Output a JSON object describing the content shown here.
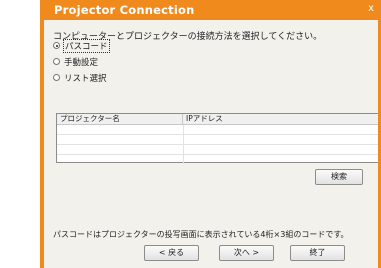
{
  "window": {
    "title": "Projector Connection",
    "close_label": "x"
  },
  "instruction": "コンピューターとプロジェクターの接続方法を選択してください。",
  "options": [
    {
      "label": "パスコード",
      "checked": true
    },
    {
      "label": "手動設定",
      "checked": false
    },
    {
      "label": "リスト選択",
      "checked": false
    }
  ],
  "table": {
    "columns": [
      "プロジェクター名",
      "IPアドレス"
    ],
    "rows": []
  },
  "search_label": "検索",
  "note": "パスコードはプロジェクターの投写画面に表示されている4桁×3組のコードです。",
  "footer": {
    "back_label": "< 戻る",
    "next_label": "次へ >",
    "finish_label": "終了"
  }
}
